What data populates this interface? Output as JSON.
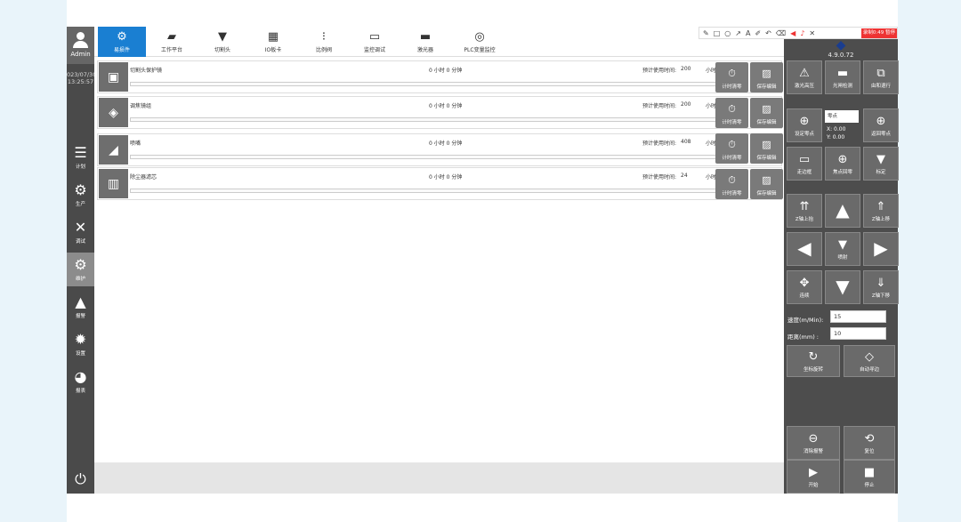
{
  "user": {
    "name": "Admin",
    "date": "023/07/30",
    "time": "13:25:57"
  },
  "sidebar": {
    "items": [
      {
        "label": "计划",
        "icon": "list-icon"
      },
      {
        "label": "生产",
        "icon": "gears-icon"
      },
      {
        "label": "调试",
        "icon": "tools-icon"
      },
      {
        "label": "维护",
        "icon": "maintenance-icon"
      },
      {
        "label": "报警",
        "icon": "warning-icon"
      },
      {
        "label": "设置",
        "icon": "gear-icon"
      },
      {
        "label": "报表",
        "icon": "pie-chart-icon"
      }
    ]
  },
  "tabs": [
    {
      "label": "易损件"
    },
    {
      "label": "工作平台"
    },
    {
      "label": "切割头"
    },
    {
      "label": "IO板卡"
    },
    {
      "label": "比例阀"
    },
    {
      "label": "监控调试"
    },
    {
      "label": "激光器"
    },
    {
      "label": "PLC变量监控"
    }
  ],
  "annotation_toolbar": {
    "recording_label": "录制0:49 暂停"
  },
  "parts": [
    {
      "title": "切割头保护镜",
      "used": "0 小时 0 分钟",
      "plan_label": "预计使用时间:",
      "plan_value": "200",
      "unit": "小时",
      "reset_label": "计时清零",
      "save_label": "保存编辑"
    },
    {
      "title": "调焦镜组",
      "used": "0 小时 0 分钟",
      "plan_label": "预计使用时间:",
      "plan_value": "200",
      "unit": "小时",
      "reset_label": "计时清零",
      "save_label": "保存编辑"
    },
    {
      "title": "喷嘴",
      "used": "0 小时 0 分钟",
      "plan_label": "预计使用时间:",
      "plan_value": "408",
      "unit": "小时",
      "reset_label": "计时清零",
      "save_label": "保存编辑"
    },
    {
      "title": "除尘器滤芯",
      "used": "0 小时 0 分钟",
      "plan_label": "预计使用时间:",
      "plan_value": "24",
      "unit": "小时",
      "reset_label": "计时清零",
      "save_label": "保存编辑"
    }
  ],
  "right_panel": {
    "version": "4.9.0.72",
    "buttons": {
      "laser_high": "激光高压",
      "shutter": "光闸检测",
      "follow_exit": "由和退行",
      "set_zero": "设定零点",
      "return_zero": "返回零点",
      "walk_edge": "走边框",
      "focus_point": "焦点回零",
      "calibrate": "标定",
      "z_up_limit": "Z轴上抬",
      "z_up": "Z轴上移",
      "spot": "喷射",
      "jog": "连续",
      "z_down": "Z轴下移",
      "coord_rotate": "坐标旋转",
      "auto_find_edge": "自动寻边",
      "clear_alarm": "消除报警",
      "reset": "复位",
      "start": "开始",
      "stop": "停止"
    },
    "zero_select": "零点",
    "x_readout": "X:  0.00",
    "y_readout": "Y:  0.00",
    "speed_label": "速度(m/Min):",
    "speed_value": "15",
    "distance_label": "距离(mm)   :",
    "distance_value": "10"
  }
}
